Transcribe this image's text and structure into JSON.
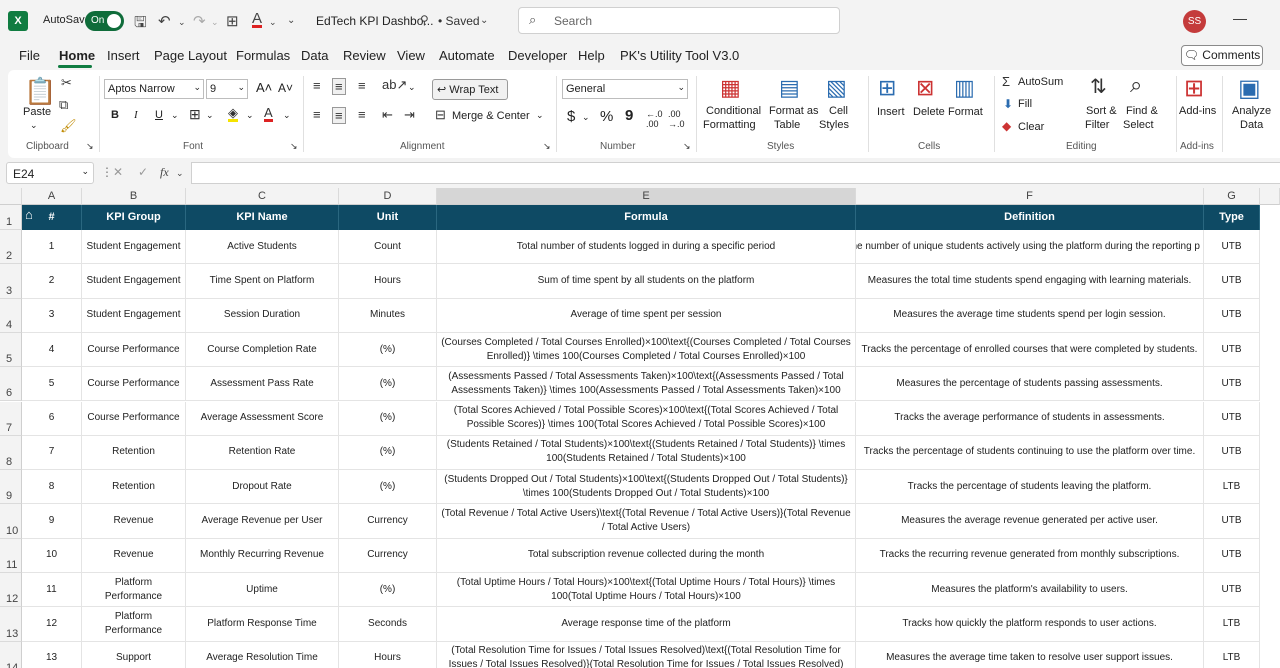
{
  "titlebar": {
    "logo": "X",
    "autosave_label": "AutoSave",
    "autosave_state": "On",
    "doc_title": "EdTech KPI Dashbo...",
    "saved_label": "• Saved",
    "search_placeholder": "Search",
    "user_initials": "SS"
  },
  "menu": {
    "items": [
      "File",
      "Home",
      "Insert",
      "Page Layout",
      "Formulas",
      "Data",
      "Review",
      "View",
      "Automate",
      "Developer",
      "Help",
      "PK's Utility Tool V3.0"
    ],
    "active": "Home",
    "comments_label": "Comments"
  },
  "ribbon": {
    "clipboard": {
      "paste": "Paste",
      "group": "Clipboard"
    },
    "font": {
      "name": "Aptos Narrow",
      "size": "9",
      "bold": "B",
      "italic": "I",
      "underline": "U",
      "group": "Font"
    },
    "alignment": {
      "wrap": "Wrap Text",
      "merge": "Merge & Center",
      "group": "Alignment"
    },
    "number": {
      "format": "General",
      "currency": "$",
      "percent": "%",
      "comma": "9",
      "group": "Number"
    },
    "styles": {
      "cond1": "Conditional",
      "cond2": "Formatting",
      "fmt1": "Format as",
      "fmt2": "Table",
      "cell1": "Cell",
      "cell2": "Styles",
      "group": "Styles"
    },
    "cells": {
      "insert": "Insert",
      "delete": "Delete",
      "format": "Format",
      "group": "Cells"
    },
    "editing": {
      "autosum": "AutoSum",
      "fill": "Fill",
      "clear": "Clear",
      "sort1": "Sort &",
      "sort2": "Filter",
      "find1": "Find &",
      "find2": "Select",
      "group": "Editing"
    },
    "addins": {
      "label": "Add-ins",
      "group": "Add-ins"
    },
    "analyze": {
      "label1": "Analyze",
      "label2": "Data"
    }
  },
  "formula_bar": {
    "name_box": "E24",
    "fx": "fx",
    "value": ""
  },
  "columns": [
    "A",
    "B",
    "C",
    "D",
    "E",
    "F",
    "G"
  ],
  "table": {
    "headers": [
      "#",
      "KPI Group",
      "KPI Name",
      "Unit",
      "Formula",
      "Definition",
      "Type"
    ],
    "rows": [
      {
        "n": "1",
        "group": "Student Engagement",
        "name": "Active Students",
        "unit": "Count",
        "formula": "Total number of students logged in during a specific period",
        "definition": "s the number of unique students actively using the platform during the reporting p",
        "type": "UTB"
      },
      {
        "n": "2",
        "group": "Student Engagement",
        "name": "Time Spent on Platform",
        "unit": "Hours",
        "formula": "Sum of time spent by all students on the platform",
        "definition": "Measures the total time students spend engaging with learning materials.",
        "type": "UTB"
      },
      {
        "n": "3",
        "group": "Student Engagement",
        "name": "Session Duration",
        "unit": "Minutes",
        "formula": "Average of time spent per session",
        "definition": "Measures the average time students spend per login session.",
        "type": "UTB"
      },
      {
        "n": "4",
        "group": "Course Performance",
        "name": "Course Completion Rate",
        "unit": "(%)",
        "formula": "(Courses Completed / Total Courses Enrolled)×100\\text{(Courses Completed / Total Courses Enrolled)} \\times 100(Courses Completed / Total Courses Enrolled)×100",
        "definition": "Tracks the percentage of enrolled courses that were completed by students.",
        "type": "UTB"
      },
      {
        "n": "5",
        "group": "Course Performance",
        "name": "Assessment Pass Rate",
        "unit": "(%)",
        "formula": "(Assessments Passed / Total Assessments Taken)×100\\text{(Assessments Passed / Total Assessments Taken)} \\times 100(Assessments Passed / Total Assessments Taken)×100",
        "definition": "Measures the percentage of students passing assessments.",
        "type": "UTB"
      },
      {
        "n": "6",
        "group": "Course Performance",
        "name": "Average Assessment Score",
        "unit": "(%)",
        "formula": "(Total Scores Achieved / Total Possible Scores)×100\\text{(Total Scores Achieved / Total Possible Scores)} \\times 100(Total Scores Achieved / Total Possible Scores)×100",
        "definition": "Tracks the average performance of students in assessments.",
        "type": "UTB"
      },
      {
        "n": "7",
        "group": "Retention",
        "name": "Retention Rate",
        "unit": "(%)",
        "formula": "(Students Retained / Total Students)×100\\text{(Students Retained / Total Students)} \\times 100(Students Retained / Total Students)×100",
        "definition": "Tracks the percentage of students continuing to use the platform over time.",
        "type": "UTB"
      },
      {
        "n": "8",
        "group": "Retention",
        "name": "Dropout Rate",
        "unit": "(%)",
        "formula": "(Students Dropped Out / Total Students)×100\\text{(Students Dropped Out / Total Students)} \\times 100(Students Dropped Out / Total Students)×100",
        "definition": "Tracks the percentage of students leaving the platform.",
        "type": "LTB"
      },
      {
        "n": "9",
        "group": "Revenue",
        "name": "Average Revenue per User",
        "unit": "Currency",
        "formula": "(Total Revenue / Total Active Users)\\text{(Total Revenue / Total Active Users)}(Total Revenue / Total Active Users)",
        "definition": "Measures the average revenue generated per active user.",
        "type": "UTB"
      },
      {
        "n": "10",
        "group": "Revenue",
        "name": "Monthly Recurring Revenue",
        "unit": "Currency",
        "formula": "Total subscription revenue collected during the month",
        "definition": "Tracks the recurring revenue generated from monthly subscriptions.",
        "type": "UTB"
      },
      {
        "n": "11",
        "group": "Platform Performance",
        "name": "Uptime",
        "unit": "(%)",
        "formula": "(Total Uptime Hours / Total Hours)×100\\text{(Total Uptime Hours / Total Hours)} \\times 100(Total Uptime Hours / Total Hours)×100",
        "definition": "Measures the platform's availability to users.",
        "type": "UTB"
      },
      {
        "n": "12",
        "group": "Platform Performance",
        "name": "Platform Response Time",
        "unit": "Seconds",
        "formula": "Average response time of the platform",
        "definition": "Tracks how quickly the platform responds to user actions.",
        "type": "LTB"
      },
      {
        "n": "13",
        "group": "Support",
        "name": "Average Resolution Time",
        "unit": "Hours",
        "formula": "(Total Resolution Time for Issues / Total Issues Resolved)\\text{(Total Resolution Time for Issues / Total Issues Resolved)}(Total Resolution Time for Issues / Total Issues Resolved)",
        "definition": "Measures the average time taken to resolve user support issues.",
        "type": "LTB"
      }
    ]
  },
  "row_numbers": [
    "1",
    "2",
    "3",
    "4",
    "5",
    "6",
    "7",
    "8",
    "9",
    "10",
    "11",
    "12",
    "13",
    "14"
  ]
}
